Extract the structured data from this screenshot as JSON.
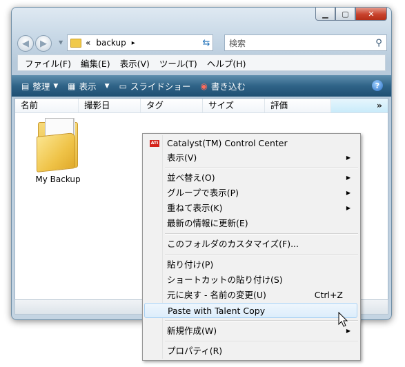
{
  "window": {
    "controls": {
      "minimize": "▁",
      "maximize": "▢",
      "close": "✕"
    }
  },
  "nav": {
    "back_icon": "arrow-left",
    "forward_icon": "arrow-right"
  },
  "address": {
    "prefix": "«",
    "path": "backup",
    "arrow": "▸"
  },
  "search": {
    "placeholder": "検索"
  },
  "menubar": {
    "items": [
      "ファイル(F)",
      "編集(E)",
      "表示(V)",
      "ツール(T)",
      "ヘルプ(H)"
    ]
  },
  "commandbar": {
    "items": [
      {
        "label": "整理",
        "icon": "organize-icon",
        "has_dropdown": true
      },
      {
        "label": "表示",
        "icon": "views-icon",
        "has_dropdown": true
      },
      {
        "label": "スライドショー",
        "icon": "slideshow-icon",
        "has_dropdown": false
      },
      {
        "label": "書き込む",
        "icon": "burn-icon",
        "has_dropdown": false
      }
    ],
    "help_label": "?"
  },
  "columns": [
    "名前",
    "撮影日",
    "タグ",
    "サイズ",
    "評価"
  ],
  "more_columns": "»",
  "files": [
    {
      "name": "My Backup",
      "icon": "folder-icon"
    }
  ],
  "context_menu": {
    "items": [
      {
        "label": "Catalyst(TM) Control Center",
        "icon": "ati-icon"
      },
      {
        "label": "表示(V)",
        "submenu": true
      },
      {
        "separator": true
      },
      {
        "label": "並べ替え(O)",
        "submenu": true
      },
      {
        "label": "グループで表示(P)",
        "submenu": true
      },
      {
        "label": "重ねて表示(K)",
        "submenu": true
      },
      {
        "label": "最新の情報に更新(E)"
      },
      {
        "separator": true
      },
      {
        "label": "このフォルダのカスタマイズ(F)..."
      },
      {
        "separator": true
      },
      {
        "label": "貼り付け(P)"
      },
      {
        "label": "ショートカットの貼り付け(S)"
      },
      {
        "label": "元に戻す - 名前の変更(U)",
        "shortcut": "Ctrl+Z"
      },
      {
        "label": "Paste with Talent Copy",
        "highlighted": true
      },
      {
        "separator": true
      },
      {
        "label": "新規作成(W)",
        "submenu": true
      },
      {
        "separator": true
      },
      {
        "label": "プロパティ(R)"
      }
    ],
    "ati_badge": "ATI",
    "submenu_arrow": "▶"
  }
}
